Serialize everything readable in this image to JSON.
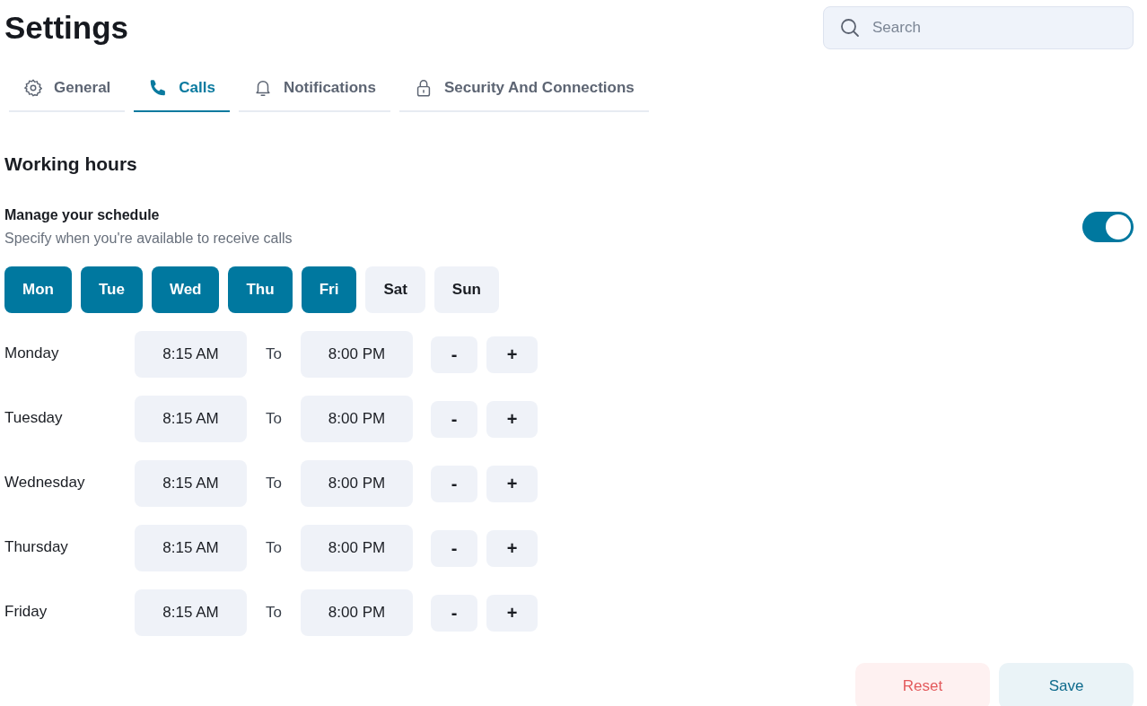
{
  "title": "Settings",
  "search": {
    "placeholder": "Search"
  },
  "tabs": [
    {
      "label": "General",
      "selected": false,
      "kind": "gear"
    },
    {
      "label": "Calls",
      "selected": true,
      "kind": "phone"
    },
    {
      "label": "Notifications",
      "selected": false,
      "kind": "bell"
    },
    {
      "label": "Security And Connections",
      "selected": false,
      "kind": "lock"
    }
  ],
  "section_title": "Working hours",
  "schedule": {
    "label": "Manage your schedule",
    "description": "Specify when you're available to receive calls",
    "on": true
  },
  "days": [
    {
      "label": "Mon",
      "selected": true
    },
    {
      "label": "Tue",
      "selected": true
    },
    {
      "label": "Wed",
      "selected": true
    },
    {
      "label": "Thu",
      "selected": true
    },
    {
      "label": "Fri",
      "selected": true
    },
    {
      "label": "Sat",
      "selected": false
    },
    {
      "label": "Sun",
      "selected": false
    }
  ],
  "hours": [
    {
      "day": "Monday",
      "from": "8:15 AM",
      "separator": "To",
      "to": "8:00 PM",
      "minus": "-",
      "plus": "+"
    },
    {
      "day": "Tuesday",
      "from": "8:15 AM",
      "separator": "To",
      "to": "8:00 PM",
      "minus": "-",
      "plus": "+"
    },
    {
      "day": "Wednesday",
      "from": "8:15 AM",
      "separator": "To",
      "to": "8:00 PM",
      "minus": "-",
      "plus": "+"
    },
    {
      "day": "Thursday",
      "from": "8:15 AM",
      "separator": "To",
      "to": "8:00 PM",
      "minus": "-",
      "plus": "+"
    },
    {
      "day": "Friday",
      "from": "8:15 AM",
      "separator": "To",
      "to": "8:00 PM",
      "minus": "-",
      "plus": "+"
    }
  ],
  "buttons": [
    {
      "label": "Reset",
      "kind": "danger"
    },
    {
      "label": "Save",
      "kind": "primary"
    }
  ]
}
